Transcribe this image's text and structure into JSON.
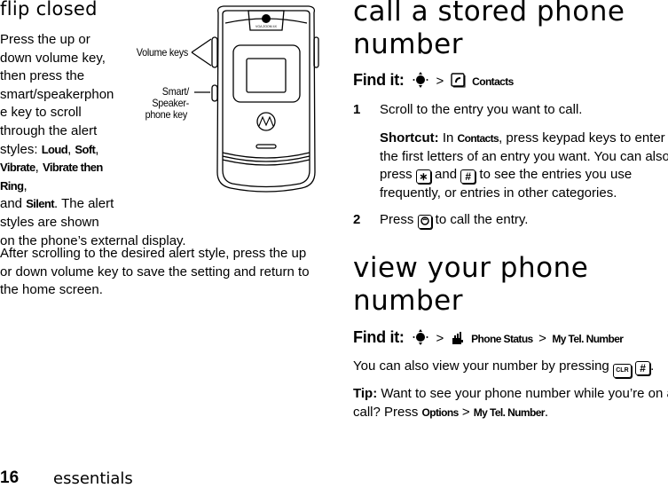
{
  "left": {
    "heading": "flip closed",
    "para1_lines": [
      "Press the up or",
      "down volume key,",
      "then press the",
      "smart/speakerphon",
      "e key to scroll",
      "through the alert"
    ],
    "styles_prefix": "styles: ",
    "alert_styles": [
      "Loud",
      "Soft",
      "Vibrate",
      "Vibrate then Ring",
      "Silent"
    ],
    "and_word": "and ",
    "after_silent": ". The alert",
    "line_shown": "styles are shown",
    "line_display": "on the phone’s external display.",
    "para2": "After scrolling to the desired alert style, press the up or down volume key to save the setting and return to the home screen."
  },
  "illustration": {
    "volume_label": "Volume keys",
    "smart_label_lines": [
      "Smart/",
      "Speaker-",
      "phone key"
    ],
    "camera_text": "VGA ZOOM 4X"
  },
  "right": {
    "section1": {
      "heading": "call a stored phone number",
      "find_label": "Find it:",
      "path": [
        "Contacts"
      ],
      "steps": [
        {
          "num": "1",
          "text": "Scroll to the entry you want to call."
        },
        {
          "num": "2",
          "prefix": "Press ",
          "suffix": " to call the entry."
        }
      ],
      "shortcut_label": "Shortcut:",
      "shortcut_in": " In ",
      "shortcut_menu": "Contacts",
      "shortcut_line1": ", press keypad keys to enter",
      "shortcut_line2": "the first letters of an entry you want. You can also",
      "shortcut_press": "press ",
      "shortcut_and": " and ",
      "shortcut_line3_end": " to see the entries you use",
      "shortcut_line4": "frequently, or entries in other categories."
    },
    "section2": {
      "heading": "view your phone number",
      "find_label": "Find it:",
      "path": [
        "Phone Status",
        "My Tel. Number"
      ],
      "also_text": "You can also view your number by pressing ",
      "tip_label": "Tip:",
      "tip_text": " Want to see your phone number while you’re on a",
      "tip_line2": "call? Press ",
      "tip_menu1": "Options",
      "tip_menu2": "My Tel. Number",
      "period": "."
    }
  },
  "keys": {
    "star": "∗",
    "hash": "#",
    "clr": "CLR",
    "gt": ">"
  },
  "footer": {
    "page_number": "16",
    "section": "essentials"
  }
}
